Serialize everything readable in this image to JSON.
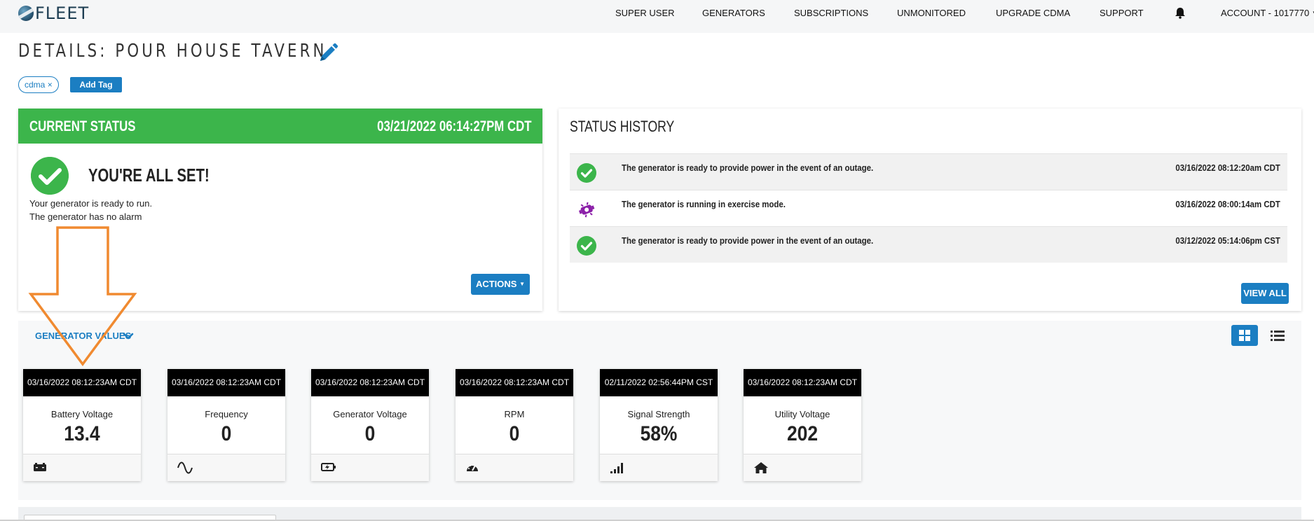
{
  "brand": {
    "name": "FLEET"
  },
  "nav": {
    "items": [
      "SUPER USER",
      "GENERATORS",
      "SUBSCRIPTIONS",
      "UNMONITORED",
      "UPGRADE CDMA",
      "SUPPORT"
    ],
    "account": "ACCOUNT - 1017770"
  },
  "page": {
    "title": "DETAILS: POUR HOUSE TAVERN"
  },
  "tags": {
    "items": [
      "cdma"
    ],
    "remove_glyph": "×",
    "add_label": "Add Tag"
  },
  "current_status": {
    "title": "CURRENT STATUS",
    "timestamp": "03/21/2022 06:14:27PM CDT",
    "headline": "YOU'RE ALL SET!",
    "lines": [
      "Your generator is ready to run.",
      "The generator has no alarm"
    ],
    "actions_label": "ACTIONS",
    "status_color": "#3cb54b"
  },
  "status_history": {
    "title": "STATUS HISTORY",
    "rows": [
      {
        "icon": "check-circle-icon",
        "message": "The generator is ready to provide power in the event of an outage.",
        "timestamp": "03/16/2022 08:12:20am CDT"
      },
      {
        "icon": "exercise-gear-icon",
        "message": "The generator is running in exercise mode.",
        "timestamp": "03/16/2022 08:00:14am CDT"
      },
      {
        "icon": "check-circle-icon",
        "message": "The generator is ready to provide power in the event of an outage.",
        "timestamp": "03/12/2022 05:14:06pm CST"
      }
    ],
    "view_all_label": "VIEW ALL"
  },
  "generator_values": {
    "toggle_label": "GENERATOR VALUES",
    "tiles": [
      {
        "timestamp": "03/16/2022 08:12:23AM CDT",
        "label": "Battery Voltage",
        "value": "13.4",
        "icon": "battery-icon"
      },
      {
        "timestamp": "03/16/2022 08:12:23AM CDT",
        "label": "Frequency",
        "value": "0",
        "icon": "sine-wave-icon"
      },
      {
        "timestamp": "03/16/2022 08:12:23AM CDT",
        "label": "Generator Voltage",
        "value": "0",
        "icon": "charging-battery-icon"
      },
      {
        "timestamp": "03/16/2022 08:12:23AM CDT",
        "label": "RPM",
        "value": "0",
        "icon": "gauge-icon"
      },
      {
        "timestamp": "02/11/2022 02:56:44PM CST",
        "label": "Signal Strength",
        "value": "58%",
        "icon": "signal-bars-icon"
      },
      {
        "timestamp": "03/16/2022 08:12:23AM CDT",
        "label": "Utility Voltage",
        "value": "202",
        "icon": "home-icon"
      }
    ]
  },
  "colors": {
    "accent": "#1b7ec2",
    "success": "#3cb54b",
    "annotation": "#f08a30",
    "exercise": "#8b1fa8"
  }
}
